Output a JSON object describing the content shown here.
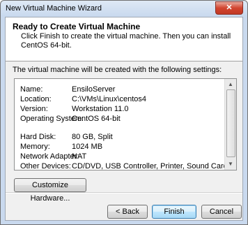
{
  "window": {
    "title": "New Virtual Machine Wizard",
    "close_glyph": "✕"
  },
  "header": {
    "title": "Ready to Create Virtual Machine",
    "subtitle": "Click Finish to create the virtual machine. Then you can install CentOS 64-bit."
  },
  "intro": "The virtual machine will be created with the following settings:",
  "summary": {
    "rows": [
      {
        "key": "Name:",
        "value": "EnsiloServer"
      },
      {
        "key": "Location:",
        "value": "C:\\VMs\\Linux\\centos4"
      },
      {
        "key": "Version:",
        "value": "Workstation 11.0"
      },
      {
        "key": "Operating System:",
        "value": "CentOS 64-bit"
      },
      {
        "key": "Hard Disk:",
        "value": "80 GB, Split"
      },
      {
        "key": "Memory:",
        "value": "1024 MB"
      },
      {
        "key": "Network Adapter:",
        "value": "NAT"
      },
      {
        "key": "Other Devices:",
        "value": "CD/DVD, USB Controller, Printer, Sound Card"
      }
    ]
  },
  "buttons": {
    "customize": "Customize Hardware...",
    "back": "< Back",
    "finish": "Finish",
    "cancel": "Cancel"
  }
}
